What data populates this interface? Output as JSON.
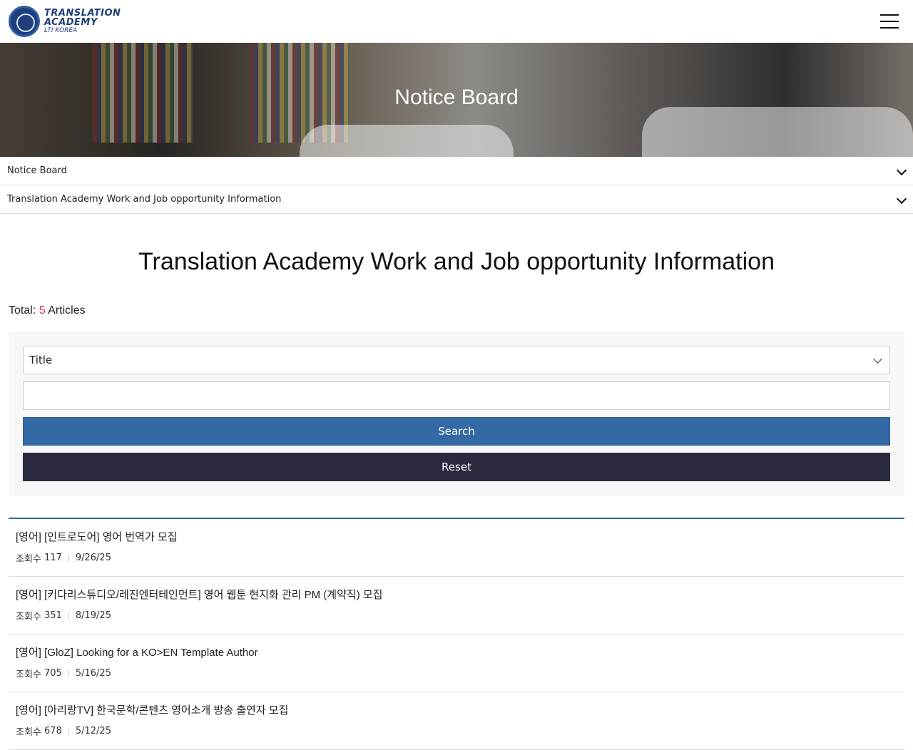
{
  "header": {
    "logo_line1": "TRANSLATION",
    "logo_line2": "ACADEMY",
    "logo_line3": "LTI KOREA"
  },
  "hero": {
    "title": "Notice Board"
  },
  "nav": {
    "primary": "Notice Board",
    "secondary": "Translation Academy Work and Job opportunity Information"
  },
  "main": {
    "title": "Translation Academy Work and Job opportunity Information",
    "total_prefix": "Total:",
    "total_count": "5",
    "total_suffix": "Articles"
  },
  "search": {
    "field_selected": "Title",
    "keyword_value": "",
    "search_label": "Search",
    "reset_label": "Reset"
  },
  "articles": [
    {
      "title": "[영어] [인트로도어] 영어 번역가 모집",
      "views_label": "조회수",
      "views": "117",
      "date": "9/26/25"
    },
    {
      "title": "[영어] [키다리스튜디오/레진엔터테인먼트] 영어 웹툰 현지화 관리 PM (계약직) 모집",
      "views_label": "조회수",
      "views": "351",
      "date": "8/19/25"
    },
    {
      "title": "[영어] [GloZ] Looking for a KO>EN Template Author",
      "views_label": "조회수",
      "views": "705",
      "date": "5/16/25"
    },
    {
      "title": "[영어] [아리랑TV] 한국문학/콘텐츠 영어소개 방송 출연자 모집",
      "views_label": "조회수",
      "views": "678",
      "date": "5/12/25"
    }
  ],
  "colors": {
    "accent": "#336aa5",
    "reset_button": "#2a2a3e",
    "count_highlight": "#d8314a"
  }
}
